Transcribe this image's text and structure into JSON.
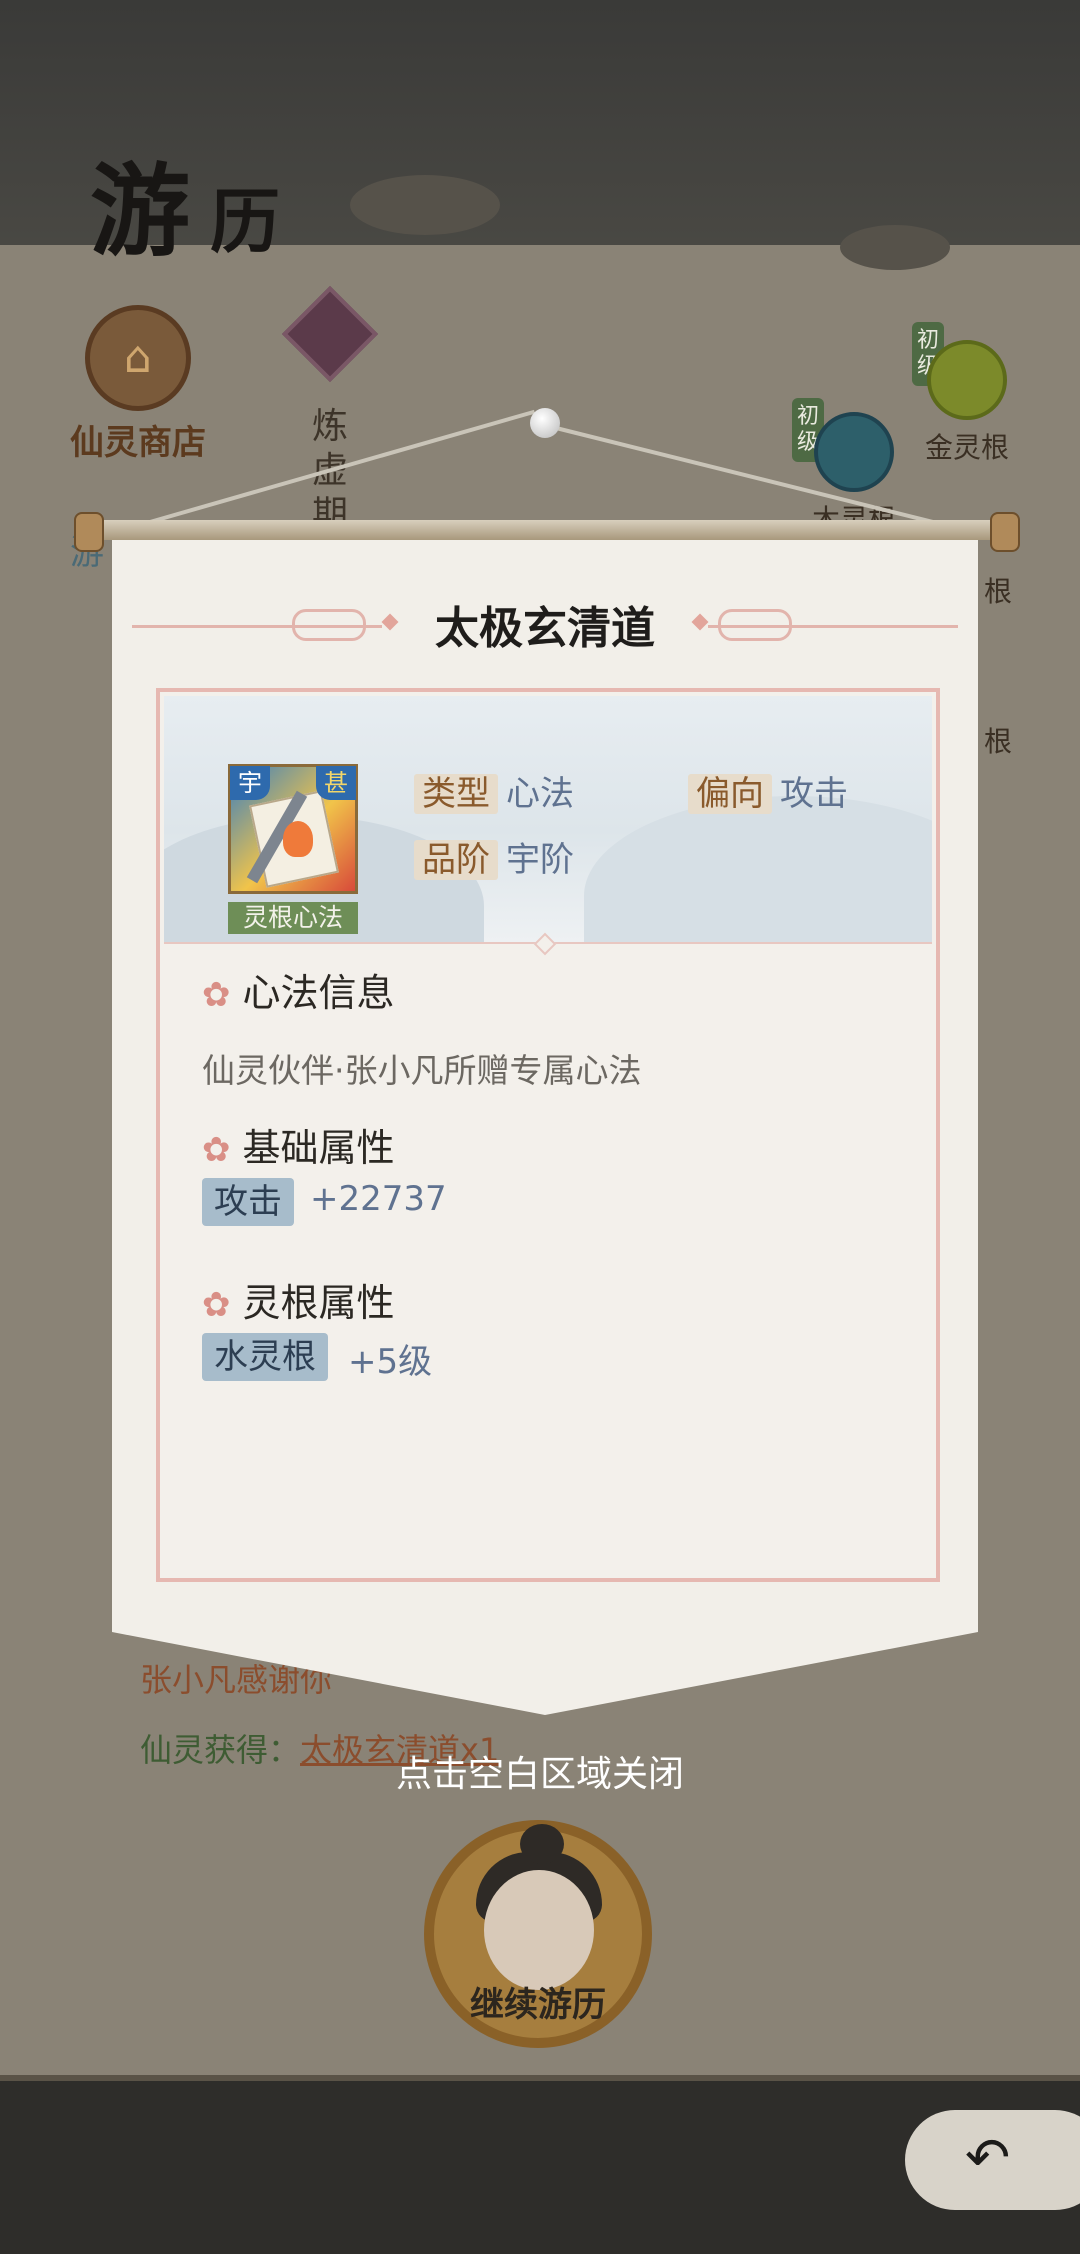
{
  "background": {
    "page_title_1": "游",
    "page_title_2": "历",
    "shop_label": "仙灵商店",
    "shop_icon": "shop-icon",
    "side_text": "炼虚期",
    "roots": [
      {
        "label": "金灵根",
        "tag": "初级",
        "color": "#7c8a2a"
      },
      {
        "label": "木灵根",
        "tag": "初级",
        "color": "#2d5f6a"
      }
    ],
    "left_fragment": "游",
    "right_fragment_1": "根",
    "right_fragment_2": "根",
    "reward_line_1": "张小凡感谢你",
    "reward_line_2_prefix": "仙灵获得：",
    "reward_line_2_item": "太极玄清道x1",
    "continue_label": "继续游历",
    "back_icon": "back-arrow-icon"
  },
  "popup": {
    "title": "太极玄清道",
    "item_badge_left": "宇",
    "item_badge_right": "甚",
    "item_category": "灵根心法",
    "type_key": "类型",
    "type_value": "心法",
    "bias_key": "偏向",
    "bias_value": "攻击",
    "grade_key": "品阶",
    "grade_value": "宇阶",
    "section_info_title": "心法信息",
    "section_info_desc": "仙灵伙伴·张小凡所赠专属心法",
    "section_base_title": "基础属性",
    "base_attr_name": "攻击",
    "base_attr_value": "+22737",
    "section_root_title": "灵根属性",
    "root_attr_name": "水灵根",
    "root_attr_value": "+5级",
    "flower_icon": "flower-icon"
  },
  "close_hint": "点击空白区域关闭",
  "colors": {
    "accent_pink": "#e6b8b1",
    "value_blue": "#5f7290",
    "key_brown": "#8a5a2c",
    "category_green": "#6e8e57"
  }
}
